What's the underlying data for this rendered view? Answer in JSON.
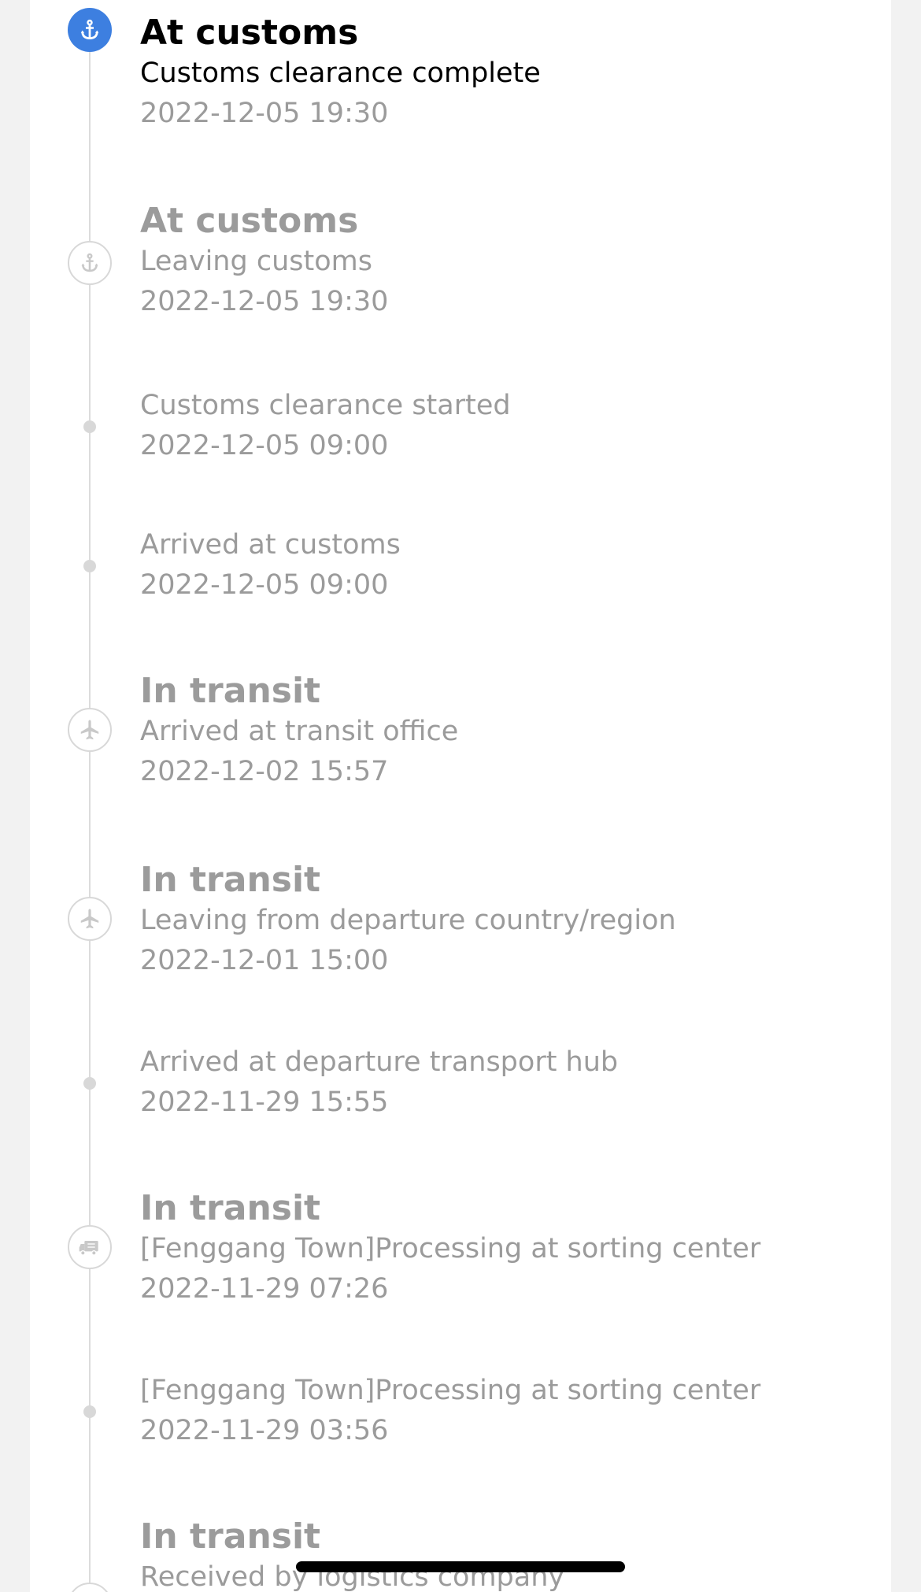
{
  "colors": {
    "accent": "#3d7fe0",
    "text_active": "#000000",
    "text_muted": "#9b9b9b",
    "rail": "#dcdcdc",
    "background": "#f2f2f2",
    "card": "#ffffff"
  },
  "timeline": {
    "events": [
      {
        "status": "At customs",
        "description": "Customs clearance complete",
        "time": "2022-12-05 19:30",
        "icon": "anchor-icon",
        "current": true
      },
      {
        "status": "At customs",
        "description": "Leaving customs",
        "time": "2022-12-05 19:30",
        "icon": "anchor-icon",
        "current": false
      },
      {
        "status": "",
        "description": "Customs clearance started",
        "time": "2022-12-05 09:00",
        "icon": "dot-icon",
        "current": false
      },
      {
        "status": "",
        "description": "Arrived at customs",
        "time": "2022-12-05 09:00",
        "icon": "dot-icon",
        "current": false
      },
      {
        "status": "In transit",
        "description": "Arrived at transit office",
        "time": "2022-12-02 15:57",
        "icon": "airplane-icon",
        "current": false
      },
      {
        "status": "In transit",
        "description": "Leaving from departure country/region",
        "time": "2022-12-01 15:00",
        "icon": "airplane-icon",
        "current": false
      },
      {
        "status": "",
        "description": "Arrived at departure transport hub",
        "time": "2022-11-29 15:55",
        "icon": "dot-icon",
        "current": false
      },
      {
        "status": "In transit",
        "description": "[Fenggang Town]Processing at sorting center",
        "time": "2022-11-29 07:26",
        "icon": "truck-icon",
        "current": false
      },
      {
        "status": "",
        "description": "[Fenggang Town]Processing at sorting center",
        "time": "2022-11-29 03:56",
        "icon": "dot-icon",
        "current": false
      },
      {
        "status": "In transit",
        "description": "Received by logistics company",
        "time": "",
        "icon": "truck-icon",
        "current": false
      }
    ]
  }
}
